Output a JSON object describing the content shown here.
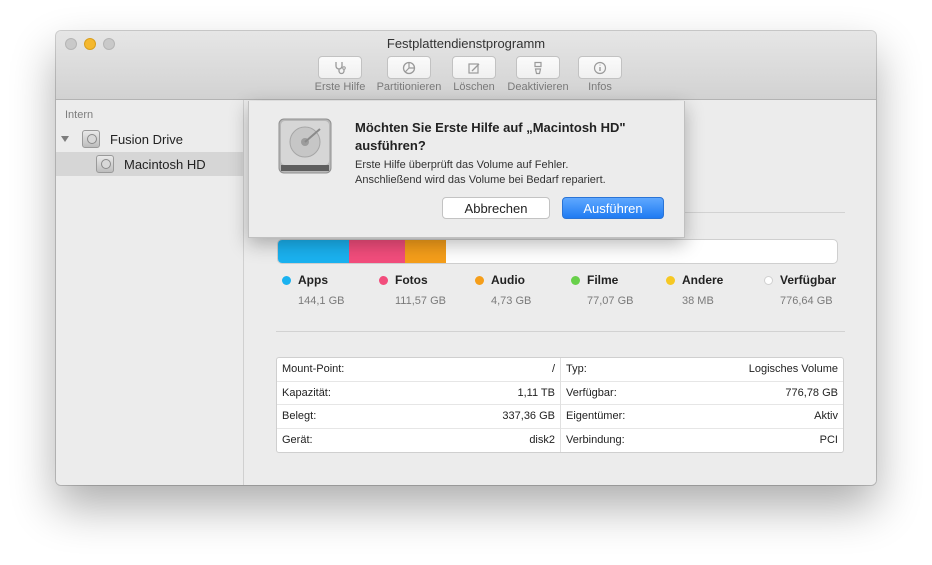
{
  "window": {
    "title": "Festplattendienstprogramm"
  },
  "toolbar": [
    {
      "label": "Erste Hilfe",
      "icon": "stethoscope-icon"
    },
    {
      "label": "Partitionieren",
      "icon": "pie-chart-icon"
    },
    {
      "label": "Löschen",
      "icon": "erase-icon"
    },
    {
      "label": "Deaktivieren",
      "icon": "eject-icon"
    },
    {
      "label": "Infos",
      "icon": "info-icon"
    }
  ],
  "sidebar": {
    "section": "Intern",
    "items": [
      {
        "label": "Fusion Drive",
        "expanded": true
      },
      {
        "label": "Macintosh HD",
        "selected": true
      }
    ]
  },
  "usage": {
    "segments": [
      {
        "name": "Apps",
        "size": "144,1 GB",
        "color": "#1ab2f0"
      },
      {
        "name": "Fotos",
        "size": "111,57 GB",
        "color": "#f24d7c"
      },
      {
        "name": "Audio",
        "size": "4,73 GB",
        "color": "#f59e1a"
      },
      {
        "name": "Filme",
        "size": "77,07 GB",
        "color": "#68d04a"
      },
      {
        "name": "Andere",
        "size": "38 MB",
        "color": "#f6c824"
      },
      {
        "name": "Verfügbar",
        "size": "776,64 GB",
        "color": "#ffffff"
      }
    ]
  },
  "info": {
    "left": [
      {
        "key": "Mount-Point:",
        "value": "/"
      },
      {
        "key": "Kapazität:",
        "value": "1,11 TB"
      },
      {
        "key": "Belegt:",
        "value": "337,36 GB"
      },
      {
        "key": "Gerät:",
        "value": "disk2"
      }
    ],
    "right": [
      {
        "key": "Typ:",
        "value": "Logisches Volume"
      },
      {
        "key": "Verfügbar:",
        "value": "776,78 GB"
      },
      {
        "key": "Eigentümer:",
        "value": "Aktiv"
      },
      {
        "key": "Verbindung:",
        "value": "PCI"
      }
    ]
  },
  "dialog": {
    "title": "Möchten Sie Erste Hilfe auf „Macintosh HD\" ausführen?",
    "body_line1": "Erste Hilfe überprüft das Volume auf Fehler.",
    "body_line2": "Anschließend wird das Volume bei Bedarf repariert.",
    "cancel_label": "Abbrechen",
    "confirm_label": "Ausführen"
  }
}
